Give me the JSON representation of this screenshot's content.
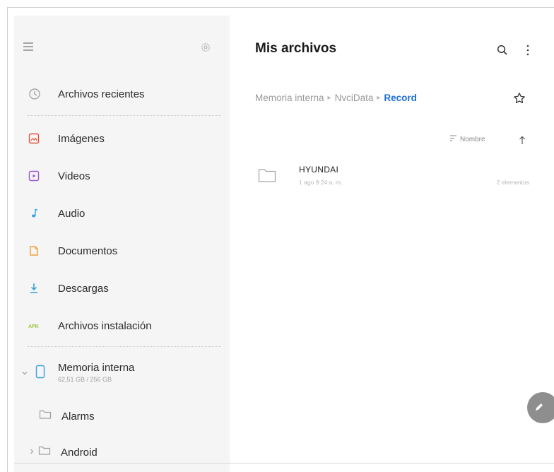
{
  "header": {
    "title": "Mis archivos"
  },
  "breadcrumb": {
    "items": [
      "Memoria interna",
      "NvciData",
      "Record"
    ]
  },
  "sort": {
    "label": "Nombre"
  },
  "files": [
    {
      "name": "HYUNDAI",
      "meta": "1 ago 9:24 a. m.",
      "count": "2 elementos"
    }
  ],
  "sidebar": {
    "recent": "Archivos recientes",
    "categories": [
      {
        "label": "Imágenes",
        "icon": "image-icon",
        "color": "#e2553f"
      },
      {
        "label": "Videos",
        "icon": "video-icon",
        "color": "#9b59d6"
      },
      {
        "label": "Audio",
        "icon": "music-icon",
        "color": "#3aa2e0"
      },
      {
        "label": "Documentos",
        "icon": "document-icon",
        "color": "#f2a33a"
      },
      {
        "label": "Descargas",
        "icon": "download-icon",
        "color": "#2f9de0"
      },
      {
        "label": "Archivos instalación",
        "icon": "apk-icon",
        "color": "#9ac43c"
      }
    ],
    "storage": {
      "name": "Memoria interna",
      "usage": "62,51 GB / 256 GB"
    },
    "folders": [
      "Alarms",
      "Android"
    ]
  }
}
